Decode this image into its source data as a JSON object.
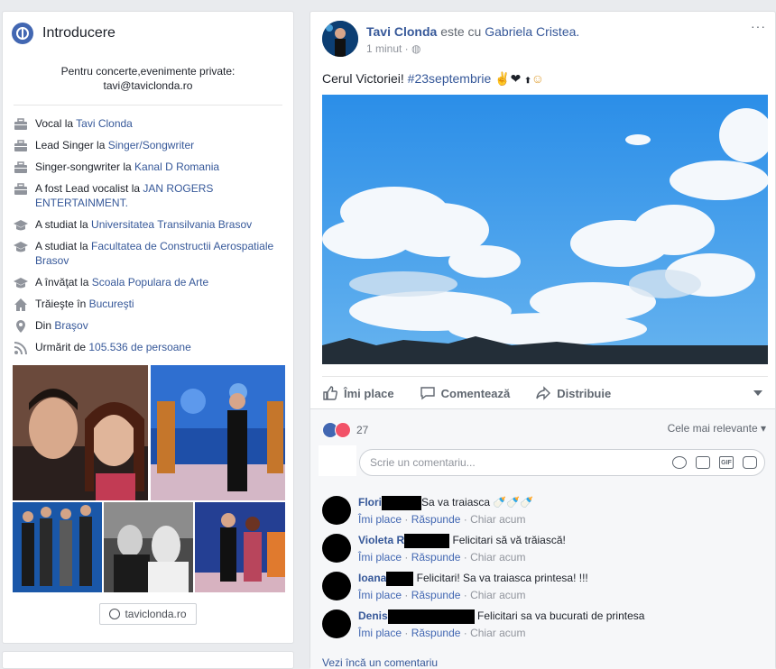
{
  "intro": {
    "title": "Introducere",
    "bio_line1": "Pentru concerte,evenimente private:",
    "bio_line2": "tavi@taviclonda.ro",
    "rows": [
      {
        "icon": "work-icon",
        "prefix": "Vocal la ",
        "link": "Tavi Clonda",
        "suffix": ""
      },
      {
        "icon": "work-icon",
        "prefix": "Lead Singer la ",
        "link": "Singer/Songwriter",
        "suffix": ""
      },
      {
        "icon": "work-icon",
        "prefix": "Singer-songwriter la ",
        "link": "Kanal D Romania",
        "suffix": ""
      },
      {
        "icon": "work-icon",
        "prefix": "A fost Lead vocalist la ",
        "link": "JAN ROGERS ENTERTAINMENT.",
        "suffix": ""
      },
      {
        "icon": "education-icon",
        "prefix": "A studiat la ",
        "link": "Universitatea Transilvania Brasov",
        "suffix": ""
      },
      {
        "icon": "education-icon",
        "prefix": "A studiat la ",
        "link": "Facultatea de Constructii Aerospatiale Brasov",
        "suffix": ""
      },
      {
        "icon": "education-icon",
        "prefix": "A învăţat la ",
        "link": "Scoala Populara de Arte",
        "suffix": ""
      },
      {
        "icon": "home-icon",
        "prefix": "Trăieşte în ",
        "link": "Bucureşti",
        "suffix": ""
      },
      {
        "icon": "location-pin-icon",
        "prefix": "Din ",
        "link": "Braşov",
        "suffix": ""
      },
      {
        "icon": "rss-icon",
        "prefix": "Urmărit de ",
        "link": "105.536 de persoane",
        "suffix": ""
      }
    ],
    "website": "taviclonda.ro"
  },
  "post": {
    "author": "Tavi Clonda",
    "with_text": " este cu ",
    "tagged": "Gabriela Cristea.",
    "time": "1 minut · ",
    "more": "···",
    "text": "Cerul Victoriei! ",
    "hashtag": "#23septembrie",
    "emoji": " ✌❤ ",
    "actions": {
      "like": "Îmi place",
      "comment": "Comentează",
      "share": "Distribuie"
    },
    "reaction_count": "27",
    "sort_label": "Cele mai relevante ▾",
    "composer_placeholder": "Scrie un comentariu...",
    "comments": [
      {
        "name": "Flori",
        "text": "Sa va traiasca 🍼🍼🍼"
      },
      {
        "name": "Violeta R",
        "text": " Felicitari să vă trăiască!"
      },
      {
        "name": "Ioana",
        "text": " Felicitari! Sa va traiasca printesa! !!!"
      },
      {
        "name": "Denis",
        "text": " Felicitari sa va bucurati de printesa"
      }
    ],
    "comment_actions": {
      "like": "Îmi place",
      "reply": "Răspunde",
      "time": "Chiar acum"
    },
    "see_more": "Vezi încă un comentariu"
  },
  "colors": {
    "link": "#365899",
    "accent": "#4267b2",
    "love": "#f25268",
    "sky": "#2f8fe0"
  }
}
